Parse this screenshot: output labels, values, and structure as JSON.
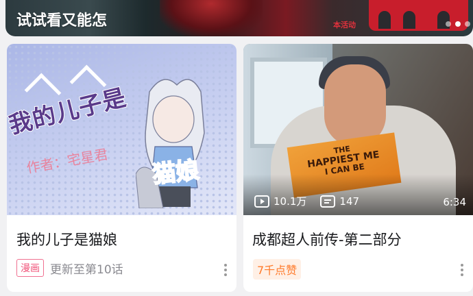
{
  "banner": {
    "title": "试试看又能怎",
    "subtitle_small": "本活动"
  },
  "cards": [
    {
      "title": "我的儿子是猫娘",
      "cover_text": "我的儿子是",
      "cover_text2": "猫娘",
      "cover_author": "作者：宅星君",
      "badge": "漫画",
      "update": "更新至第10话"
    },
    {
      "title": "成都超人前传-第二部分",
      "book_line1": "THE",
      "book_line2": "HAPPIEST ME",
      "book_line3": "I CAN BE",
      "views": "10.1万",
      "comments": "147",
      "duration": "6:34",
      "badge": "7千点赞"
    }
  ]
}
